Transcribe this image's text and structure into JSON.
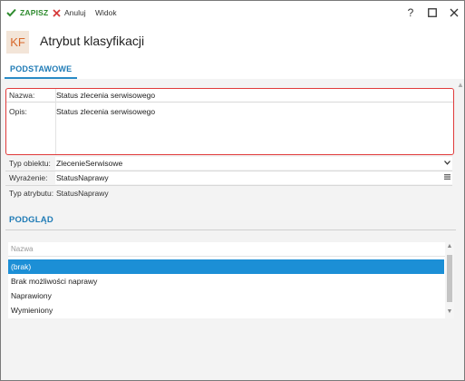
{
  "toolbar": {
    "save_label": "ZAPISZ",
    "cancel_label": "Anuluj",
    "view_label": "Widok"
  },
  "window_controls": {
    "help": "?",
    "maximize": "☐",
    "close": "✕"
  },
  "header": {
    "badge": "KF",
    "title": "Atrybut klasyfikacji"
  },
  "tabs": [
    {
      "label": "PODSTAWOWE",
      "active": true
    }
  ],
  "form": {
    "nazwa_label": "Nazwa:",
    "nazwa_value": "Status zlecenia serwisowego",
    "opis_label": "Opis:",
    "opis_value": "Status zlecenia serwisowego",
    "typ_obiektu_label": "Typ obiektu:",
    "typ_obiektu_value": "ZlecenieSerwisowe",
    "wyrazenie_label": "Wyrażenie:",
    "wyrazenie_value": "StatusNaprawy",
    "typ_atrybutu_label": "Typ atrybutu:",
    "typ_atrybutu_value": "StatusNaprawy"
  },
  "preview": {
    "title": "PODGLĄD",
    "column_header": "Nazwa",
    "rows": [
      "(brak)",
      "Brak możliwości naprawy",
      "Naprawiony",
      "Wymieniony"
    ],
    "selected_index": 0
  },
  "colors": {
    "accent": "#1f7bb6",
    "selection": "#1c8fd6",
    "save_green": "#2e8b2e",
    "cancel_red": "#d63a3a",
    "highlight_border": "#e03a3a",
    "badge_bg": "#f3e5d8",
    "badge_fg": "#d8682a"
  },
  "icons": {
    "save": "check-icon",
    "cancel": "x-icon",
    "dropdown": "chevron-down-icon",
    "expression": "menu-icon"
  }
}
